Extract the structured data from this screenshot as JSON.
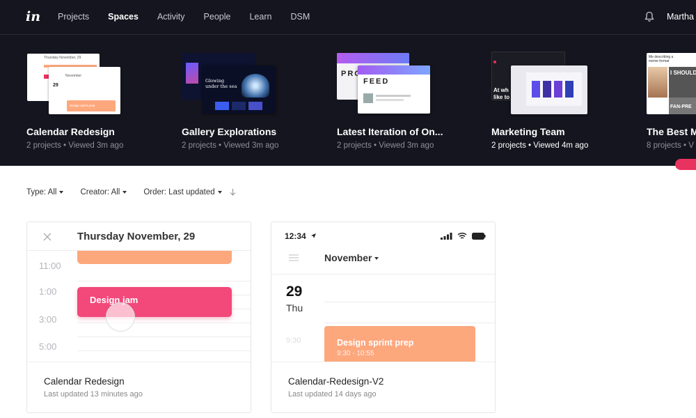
{
  "nav": {
    "logo": "in",
    "items": [
      "Projects",
      "Spaces",
      "Activity",
      "People",
      "Learn",
      "DSM"
    ],
    "active_index": 1,
    "user": "Martha I"
  },
  "spaces": [
    {
      "title": "Calendar Redesign",
      "meta": "2 projects • Viewed 3m ago",
      "thumb_text": [
        "Thursday November, 29",
        "November",
        "29",
        "Design sprint prep"
      ]
    },
    {
      "title": "Gallery Explorations",
      "meta": "2 projects • Viewed 3m ago",
      "thumb_text": [
        "Glowing under the sea"
      ]
    },
    {
      "title": "Latest Iteration of On...",
      "meta": "2 projects • Viewed 3m ago",
      "thumb_text": [
        "PRO",
        "FEED"
      ]
    },
    {
      "title": "Marketing Team",
      "meta": "2 projects • Viewed 4m ago",
      "thumb_text": [
        "At wh like to"
      ]
    },
    {
      "title": "The Best M",
      "meta": "8 projects • V",
      "thumb_text": [
        "Me describing a meme format",
        "I SHOULD",
        "FAN-PRE"
      ]
    }
  ],
  "filters": {
    "type": "Type: All",
    "creator": "Creator: All",
    "order": "Order: Last updated"
  },
  "cards": [
    {
      "name": "Calendar Redesign",
      "updated": "Last updated 13 minutes ago",
      "header": "Thursday November, 29",
      "times": [
        "11:00",
        "1:00",
        "3:00",
        "5:00"
      ],
      "event": "Design jam"
    },
    {
      "name": "Calendar-Redesign-V2",
      "updated": "Last updated 14 days ago",
      "clock": "12:34",
      "month": "November",
      "day_num": "29",
      "day_name": "Thu",
      "time_faded": "9:30",
      "event": "Design sprint prep",
      "event_time": "9:30 - 10:55"
    }
  ],
  "colors": {
    "dark_bg": "#15151f",
    "accent_pink": "#e8325f",
    "salmon": "#fda77d"
  }
}
